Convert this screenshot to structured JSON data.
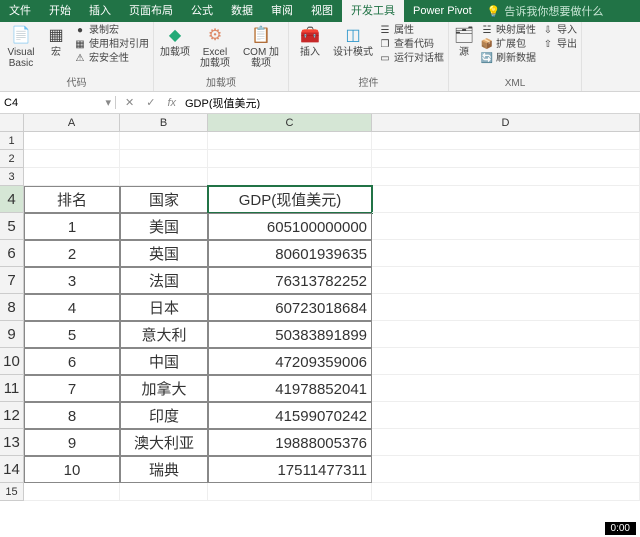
{
  "tabs": {
    "file": "文件",
    "start": "开始",
    "insert": "插入",
    "layout": "页面布局",
    "formula": "公式",
    "data": "数据",
    "review": "审阅",
    "view": "视图",
    "dev": "开发工具",
    "pivot": "Power Pivot",
    "tellme": "告诉我你想要做什么"
  },
  "ribbon": {
    "code": {
      "visualbasic": "Visual Basic",
      "macro": "宏",
      "record": "录制宏",
      "relref": "使用相对引用",
      "security": "宏安全性",
      "group": "代码"
    },
    "addin": {
      "addin": "加载项",
      "excel": "Excel\n加载项",
      "com": "COM 加载项",
      "group": "加载项"
    },
    "ctrl": {
      "insert": "插入",
      "design": "设计模式",
      "props": "属性",
      "viewcode": "查看代码",
      "dialog": "运行对话框",
      "group": "控件"
    },
    "xml": {
      "source": "源",
      "mapprops": "映射属性",
      "expand": "扩展包",
      "refresh": "刷新数据",
      "import": "导入",
      "export": "导出",
      "group": "XML"
    }
  },
  "formula": {
    "namebox": "C4",
    "fx": "fx",
    "value": "GDP(现值美元)"
  },
  "columns": [
    "A",
    "B",
    "C",
    "D"
  ],
  "rows_empty": [
    "1",
    "2",
    "3"
  ],
  "rows_data": [
    "4",
    "5",
    "6",
    "7",
    "8",
    "9",
    "10",
    "11",
    "12",
    "13",
    "14"
  ],
  "row_tail": "15",
  "header": {
    "rank": "排名",
    "country": "国家",
    "gdp": "GDP(现值美元)"
  },
  "chart_data": {
    "type": "table",
    "title": "GDP(现值美元)",
    "columns": [
      "排名",
      "国家",
      "GDP(现值美元)"
    ],
    "rows": [
      {
        "rank": "1",
        "country": "美国",
        "gdp": "605100000000"
      },
      {
        "rank": "2",
        "country": "英国",
        "gdp": "80601939635"
      },
      {
        "rank": "3",
        "country": "法国",
        "gdp": "76313782252"
      },
      {
        "rank": "4",
        "country": "日本",
        "gdp": "60723018684"
      },
      {
        "rank": "5",
        "country": "意大利",
        "gdp": "50383891899"
      },
      {
        "rank": "6",
        "country": "中国",
        "gdp": "47209359006"
      },
      {
        "rank": "7",
        "country": "加拿大",
        "gdp": "41978852041"
      },
      {
        "rank": "8",
        "country": "印度",
        "gdp": "41599070242"
      },
      {
        "rank": "9",
        "country": "澳大利亚",
        "gdp": "19888005376"
      },
      {
        "rank": "10",
        "country": "瑞典",
        "gdp": "17511477311"
      }
    ]
  },
  "badge": "0:00"
}
